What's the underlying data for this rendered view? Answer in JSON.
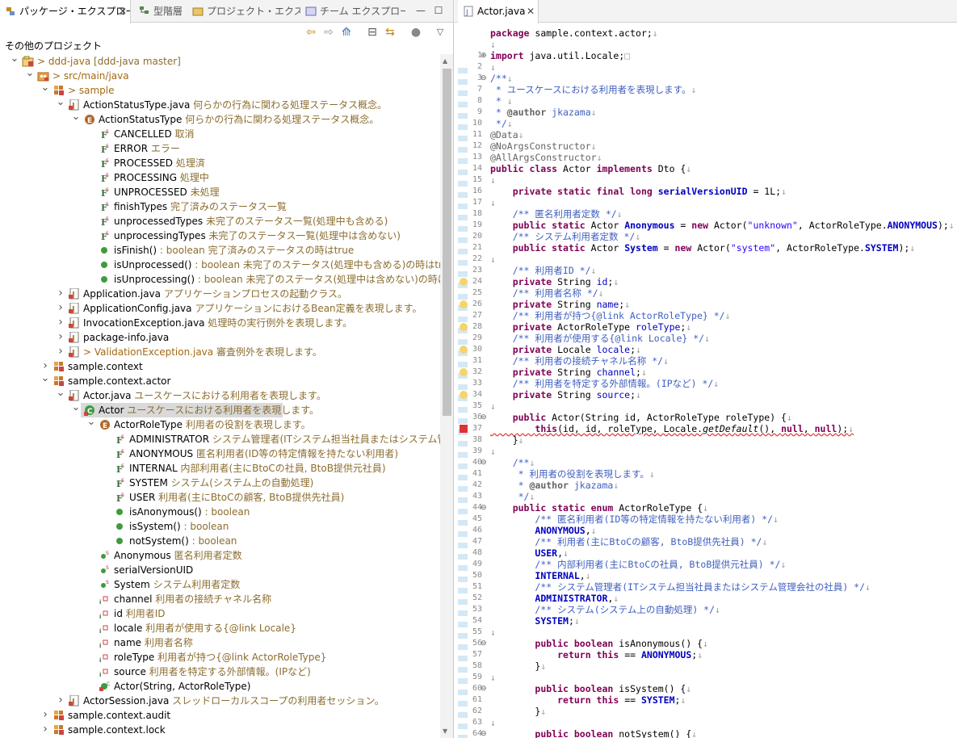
{
  "left_tabs": [
    {
      "label": "パッケージ・エクスプローラー",
      "active": true
    },
    {
      "label": "型階層",
      "active": false
    },
    {
      "label": "プロジェクト・エクスプロ...",
      "active": false
    },
    {
      "label": "チーム エクスプローラー",
      "active": false
    }
  ],
  "other_projects_label": "その他のプロジェクト",
  "tree": [
    {
      "depth": 0,
      "tw": "open",
      "icon": "project",
      "label": "> ddd-java",
      "desc": " [ddd-java master]"
    },
    {
      "depth": 1,
      "tw": "open",
      "icon": "srcfolder",
      "label": "> src/main/java",
      "desc": ""
    },
    {
      "depth": 2,
      "tw": "open",
      "icon": "package",
      "label": "> sample",
      "desc": ""
    },
    {
      "depth": 3,
      "tw": "open",
      "icon": "java",
      "label": "ActionStatusType.java",
      "desc": " 何らかの行為に関わる処理ステータス概念。"
    },
    {
      "depth": 4,
      "tw": "open",
      "icon": "enum",
      "label": "ActionStatusType",
      "desc": " 何らかの行為に関わる処理ステータス概念。"
    },
    {
      "depth": 5,
      "tw": "none",
      "icon": "sfield",
      "label": "CANCELLED",
      "desc": " 取消"
    },
    {
      "depth": 5,
      "tw": "none",
      "icon": "sfield",
      "label": "ERROR",
      "desc": " エラー"
    },
    {
      "depth": 5,
      "tw": "none",
      "icon": "sfield",
      "label": "PROCESSED",
      "desc": " 処理済"
    },
    {
      "depth": 5,
      "tw": "none",
      "icon": "sfield",
      "label": "PROCESSING",
      "desc": " 処理中"
    },
    {
      "depth": 5,
      "tw": "none",
      "icon": "sfield",
      "label": "UNPROCESSED",
      "desc": " 未処理"
    },
    {
      "depth": 5,
      "tw": "none",
      "icon": "sfield",
      "label": "finishTypes",
      "desc": " 完了済みのステータス一覧"
    },
    {
      "depth": 5,
      "tw": "none",
      "icon": "sfield",
      "label": "unprocessedTypes",
      "desc": " 未完了のステータス一覧(処理中も含める)"
    },
    {
      "depth": 5,
      "tw": "none",
      "icon": "sfield",
      "label": "unprocessingTypes",
      "desc": " 未完了のステータス一覧(処理中は含めない)"
    },
    {
      "depth": 5,
      "tw": "none",
      "icon": "method",
      "label": "isFinish()",
      "desc": " : boolean 完了済みのステータスの時はtrue"
    },
    {
      "depth": 5,
      "tw": "none",
      "icon": "method",
      "label": "isUnprocessed()",
      "desc": " : boolean 未完了のステータス(処理中も含める)の時はtrue"
    },
    {
      "depth": 5,
      "tw": "none",
      "icon": "method",
      "label": "isUnprocessing()",
      "desc": " : boolean 未完了のステータス(処理中は含めない)の時はtrue"
    },
    {
      "depth": 3,
      "tw": "closed",
      "icon": "java",
      "label": "Application.java",
      "desc": " アプリケーションプロセスの起動クラス。"
    },
    {
      "depth": 3,
      "tw": "closed",
      "icon": "java",
      "label": "ApplicationConfig.java",
      "desc": " アプリケーションにおけるBean定義を表現します。"
    },
    {
      "depth": 3,
      "tw": "closed",
      "icon": "java",
      "label": "InvocationException.java",
      "desc": " 処理時の実行例外を表現します。"
    },
    {
      "depth": 3,
      "tw": "closed",
      "icon": "java",
      "label": "package-info.java",
      "desc": ""
    },
    {
      "depth": 3,
      "tw": "closed",
      "icon": "java",
      "label": "> ValidationException.java",
      "desc": " 審査例外を表現します。"
    },
    {
      "depth": 2,
      "tw": "closed",
      "icon": "package",
      "label": "sample.context",
      "desc": ""
    },
    {
      "depth": 2,
      "tw": "open",
      "icon": "package",
      "label": "sample.context.actor",
      "desc": ""
    },
    {
      "depth": 3,
      "tw": "open",
      "icon": "java",
      "label": "Actor.java",
      "desc": " ユースケースにおける利用者を表現します。"
    },
    {
      "depth": 4,
      "tw": "open",
      "icon": "class",
      "label": "Actor",
      "desc": " ユースケースにおける利用者を表現します。",
      "selected": true
    },
    {
      "depth": 5,
      "tw": "open",
      "icon": "enum",
      "label": "ActorRoleType",
      "desc": " 利用者の役割を表現します。"
    },
    {
      "depth": 6,
      "tw": "none",
      "icon": "sfield",
      "label": "ADMINISTRATOR",
      "desc": " システム管理者(ITシステム担当社員またはシステム管理会社"
    },
    {
      "depth": 6,
      "tw": "none",
      "icon": "sfield",
      "label": "ANONYMOUS",
      "desc": " 匿名利用者(ID等の特定情報を持たない利用者)"
    },
    {
      "depth": 6,
      "tw": "none",
      "icon": "sfield",
      "label": "INTERNAL",
      "desc": " 内部利用者(主にBtoCの社員, BtoB提供元社員)"
    },
    {
      "depth": 6,
      "tw": "none",
      "icon": "sfield",
      "label": "SYSTEM",
      "desc": " システム(システム上の自動処理)"
    },
    {
      "depth": 6,
      "tw": "none",
      "icon": "sfield",
      "label": "USER",
      "desc": " 利用者(主にBtoCの顧客, BtoB提供先社員)"
    },
    {
      "depth": 6,
      "tw": "none",
      "icon": "method",
      "label": "isAnonymous()",
      "desc": " : boolean"
    },
    {
      "depth": 6,
      "tw": "none",
      "icon": "method",
      "label": "isSystem()",
      "desc": " : boolean"
    },
    {
      "depth": 6,
      "tw": "none",
      "icon": "method",
      "label": "notSystem()",
      "desc": " : boolean"
    },
    {
      "depth": 5,
      "tw": "none",
      "icon": "sconst",
      "label": "Anonymous",
      "desc": " 匿名利用者定数"
    },
    {
      "depth": 5,
      "tw": "none",
      "icon": "sconst",
      "label": "serialVersionUID",
      "desc": ""
    },
    {
      "depth": 5,
      "tw": "none",
      "icon": "sconst",
      "label": "System",
      "desc": " システム利用者定数"
    },
    {
      "depth": 5,
      "tw": "none",
      "icon": "pfield",
      "label": "channel",
      "desc": " 利用者の接続チャネル名称"
    },
    {
      "depth": 5,
      "tw": "none",
      "icon": "pfield",
      "label": "id",
      "desc": " 利用者ID"
    },
    {
      "depth": 5,
      "tw": "none",
      "icon": "pfield",
      "label": "locale",
      "desc": " 利用者が使用する{@link Locale}"
    },
    {
      "depth": 5,
      "tw": "none",
      "icon": "pfield",
      "label": "name",
      "desc": " 利用者名称"
    },
    {
      "depth": 5,
      "tw": "none",
      "icon": "pfield",
      "label": "roleType",
      "desc": " 利用者が持つ{@link ActorRoleType}"
    },
    {
      "depth": 5,
      "tw": "none",
      "icon": "pfield",
      "label": "source",
      "desc": " 利用者を特定する外部情報。(IPなど)"
    },
    {
      "depth": 5,
      "tw": "none",
      "icon": "ctor",
      "label": "Actor(String, ActorRoleType)",
      "desc": ""
    },
    {
      "depth": 3,
      "tw": "closed",
      "icon": "java",
      "label": "ActorSession.java",
      "desc": " スレッドローカルスコープの利用者セッション。"
    },
    {
      "depth": 2,
      "tw": "closed",
      "icon": "package",
      "label": "sample.context.audit",
      "desc": ""
    },
    {
      "depth": 2,
      "tw": "closed",
      "icon": "package",
      "label": "sample.context.lock",
      "desc": ""
    }
  ],
  "editor": {
    "tab_label": "Actor.java",
    "lines": [
      {
        "n": "1",
        "html": "<span class='kw'>package</span> sample.context.actor;<span class='nl'>↓</span>"
      },
      {
        "n": "2",
        "html": "<span class='nl'>↓</span>"
      },
      {
        "n": "3",
        "html": "<span class='kw'>import</span> java.util.Locale;<span class='nl'>□</span>"
      },
      {
        "n": "7",
        "html": "<span class='nl'>↓</span>"
      },
      {
        "n": "8",
        "html": "<span class='cm'>/**</span><span class='nl'>↓</span>"
      },
      {
        "n": "9",
        "html": "<span class='cm'> * ユースケースにおける利用者を表現します。</span><span class='nl'>↓</span>"
      },
      {
        "n": "10",
        "html": "<span class='cm'> * </span><span class='nl'>↓</span>"
      },
      {
        "n": "11",
        "html": "<span class='cm'> * </span><span class='an'><b>@author</b></span><span class='cm'> jkazama</span><span class='nl'>↓</span>"
      },
      {
        "n": "12",
        "html": "<span class='cm'> */</span><span class='nl'>↓</span>"
      },
      {
        "n": "13",
        "html": "<span class='an'>@Data</span><span class='nl'>↓</span>"
      },
      {
        "n": "14",
        "html": "<span class='an'>@NoArgsConstructor</span><span class='nl'>↓</span>"
      },
      {
        "n": "15",
        "html": "<span class='an'>@AllArgsConstructor</span><span class='nl'>↓</span>"
      },
      {
        "n": "16",
        "html": "<span class='kw'>public class</span> Actor <span class='kw'>implements</span> Dto {<span class='nl'>↓</span>"
      },
      {
        "n": "17",
        "html": "<span class='nl'>↓</span>"
      },
      {
        "n": "18",
        "html": "    <span class='kw'>private static final long</span> <span class='sf'>serialVersionUID</span> = 1L;<span class='nl'>↓</span>"
      },
      {
        "n": "19",
        "html": "<span class='nl'>↓</span>"
      },
      {
        "n": "20",
        "html": "    <span class='cm'>/** 匿名利用者定数 */</span><span class='nl'>↓</span>"
      },
      {
        "n": "21",
        "html": "    <span class='kw'>public static</span> Actor <span class='sf'>Anonymous</span> = <span class='kw'>new</span> Actor(<span class='st'>\"unknown\"</span>, ActorRoleType.<span class='sf'>ANONYMOUS</span>);<span class='nl'>↓</span>"
      },
      {
        "n": "22",
        "html": "    <span class='cm'>/** システム利用者定数 */</span><span class='nl'>↓</span>"
      },
      {
        "n": "23",
        "html": "    <span class='kw'>public static</span> Actor <span class='sf'>System</span> = <span class='kw'>new</span> Actor(<span class='st'>\"system\"</span>, ActorRoleType.<span class='sf'>SYSTEM</span>);<span class='nl'>↓</span>"
      },
      {
        "n": "24",
        "html": "<span class='nl'>↓</span>"
      },
      {
        "n": "25",
        "html": "    <span class='cm'>/** 利用者ID */</span><span class='nl'>↓</span>"
      },
      {
        "n": "26",
        "html": "    <span class='kw'>private</span> String <span class='fd'>id</span>;<span class='nl'>↓</span>"
      },
      {
        "n": "27",
        "html": "    <span class='cm'>/** 利用者名称 */</span><span class='nl'>↓</span>"
      },
      {
        "n": "28",
        "html": "    <span class='kw'>private</span> String <span class='fd'>name</span>;<span class='nl'>↓</span>"
      },
      {
        "n": "29",
        "html": "    <span class='cm'>/** 利用者が持つ{@link ActorRoleType} */</span><span class='nl'>↓</span>"
      },
      {
        "n": "30",
        "html": "    <span class='kw'>private</span> ActorRoleType <span class='fd'>roleType</span>;<span class='nl'>↓</span>"
      },
      {
        "n": "31",
        "html": "    <span class='cm'>/** 利用者が使用する{@link Locale} */</span><span class='nl'>↓</span>"
      },
      {
        "n": "32",
        "html": "    <span class='kw'>private</span> Locale <span class='fd'>locale</span>;<span class='nl'>↓</span>"
      },
      {
        "n": "33",
        "html": "    <span class='cm'>/** 利用者の接続チャネル名称 */</span><span class='nl'>↓</span>"
      },
      {
        "n": "34",
        "html": "    <span class='kw'>private</span> String <span class='fd'>channel</span>;<span class='nl'>↓</span>"
      },
      {
        "n": "35",
        "html": "    <span class='cm'>/** 利用者を特定する外部情報。(IPなど) */</span><span class='nl'>↓</span>"
      },
      {
        "n": "36",
        "html": "    <span class='kw'>private</span> String <span class='fd'>source</span>;<span class='nl'>↓</span>"
      },
      {
        "n": "37",
        "html": "<span class='nl'>↓</span>"
      },
      {
        "n": "38",
        "html": "    <span class='kw'>public</span> Actor(String id, ActorRoleType roleType) {<span class='nl'>↓</span>"
      },
      {
        "n": "39",
        "html": "        <span class='kw'>this</span>(id, id, roleType, Locale.<i>getDefault</i>(), <span class='kw'>null</span>, <span class='kw'>null</span>);<span class='nl'>↓</span>"
      },
      {
        "n": "40",
        "html": "    }<span class='nl'>↓</span>"
      },
      {
        "n": "41",
        "html": "<span class='nl'>↓</span>"
      },
      {
        "n": "42",
        "html": "    <span class='cm'>/**</span><span class='nl'>↓</span>"
      },
      {
        "n": "43",
        "html": "<span class='cm'>     * 利用者の役割を表現します。</span><span class='nl'>↓</span>"
      },
      {
        "n": "44",
        "html": "<span class='cm'>     * </span><span class='an'><b>@author</b></span><span class='cm'> jkazama</span><span class='nl'>↓</span>"
      },
      {
        "n": "45",
        "html": "<span class='cm'>     */</span><span class='nl'>↓</span>"
      },
      {
        "n": "46",
        "html": "    <span class='kw'>public static enum</span> ActorRoleType {<span class='nl'>↓</span>"
      },
      {
        "n": "47",
        "html": "        <span class='cm'>/** 匿名利用者(ID等の特定情報を持たない利用者) */</span><span class='nl'>↓</span>"
      },
      {
        "n": "48",
        "html": "        <span class='sf'>ANONYMOUS</span>,<span class='nl'>↓</span>"
      },
      {
        "n": "49",
        "html": "        <span class='cm'>/** 利用者(主にBtoCの顧客, BtoB提供先社員) */</span><span class='nl'>↓</span>"
      },
      {
        "n": "50",
        "html": "        <span class='sf'>USER</span>,<span class='nl'>↓</span>"
      },
      {
        "n": "51",
        "html": "        <span class='cm'>/** 内部利用者(主にBtoCの社員, BtoB提供元社員) */</span><span class='nl'>↓</span>"
      },
      {
        "n": "52",
        "html": "        <span class='sf'>INTERNAL</span>,<span class='nl'>↓</span>"
      },
      {
        "n": "53",
        "html": "        <span class='cm'>/** システム管理者(ITシステム担当社員またはシステム管理会社の社員) */</span><span class='nl'>↓</span>"
      },
      {
        "n": "54",
        "html": "        <span class='sf'>ADMINISTRATOR</span>,<span class='nl'>↓</span>"
      },
      {
        "n": "55",
        "html": "        <span class='cm'>/** システム(システム上の自動処理) */</span><span class='nl'>↓</span>"
      },
      {
        "n": "56",
        "html": "        <span class='sf'>SYSTEM</span>;<span class='nl'>↓</span>"
      },
      {
        "n": "57",
        "html": "<span class='nl'>↓</span>"
      },
      {
        "n": "58",
        "html": "        <span class='kw'>public boolean</span> isAnonymous() {<span class='nl'>↓</span>"
      },
      {
        "n": "59",
        "html": "            <span class='kw'>return this</span> == <span class='sf'>ANONYMOUS</span>;<span class='nl'>↓</span>"
      },
      {
        "n": "60",
        "html": "        }<span class='nl'>↓</span>"
      },
      {
        "n": "61",
        "html": "<span class='nl'>↓</span>"
      },
      {
        "n": "62",
        "html": "        <span class='kw'>public boolean</span> isSystem() {<span class='nl'>↓</span>"
      },
      {
        "n": "63",
        "html": "            <span class='kw'>return this</span> == <span class='sf'>SYSTEM</span>;<span class='nl'>↓</span>"
      },
      {
        "n": "64",
        "html": "        }<span class='nl'>↓</span>"
      },
      {
        "n": "65",
        "html": "<span class='nl'>↓</span>"
      },
      {
        "n": "66",
        "html": "        <span class='kw'>public boolean</span> notSystem() {<span class='nl'>↓</span>"
      }
    ]
  }
}
